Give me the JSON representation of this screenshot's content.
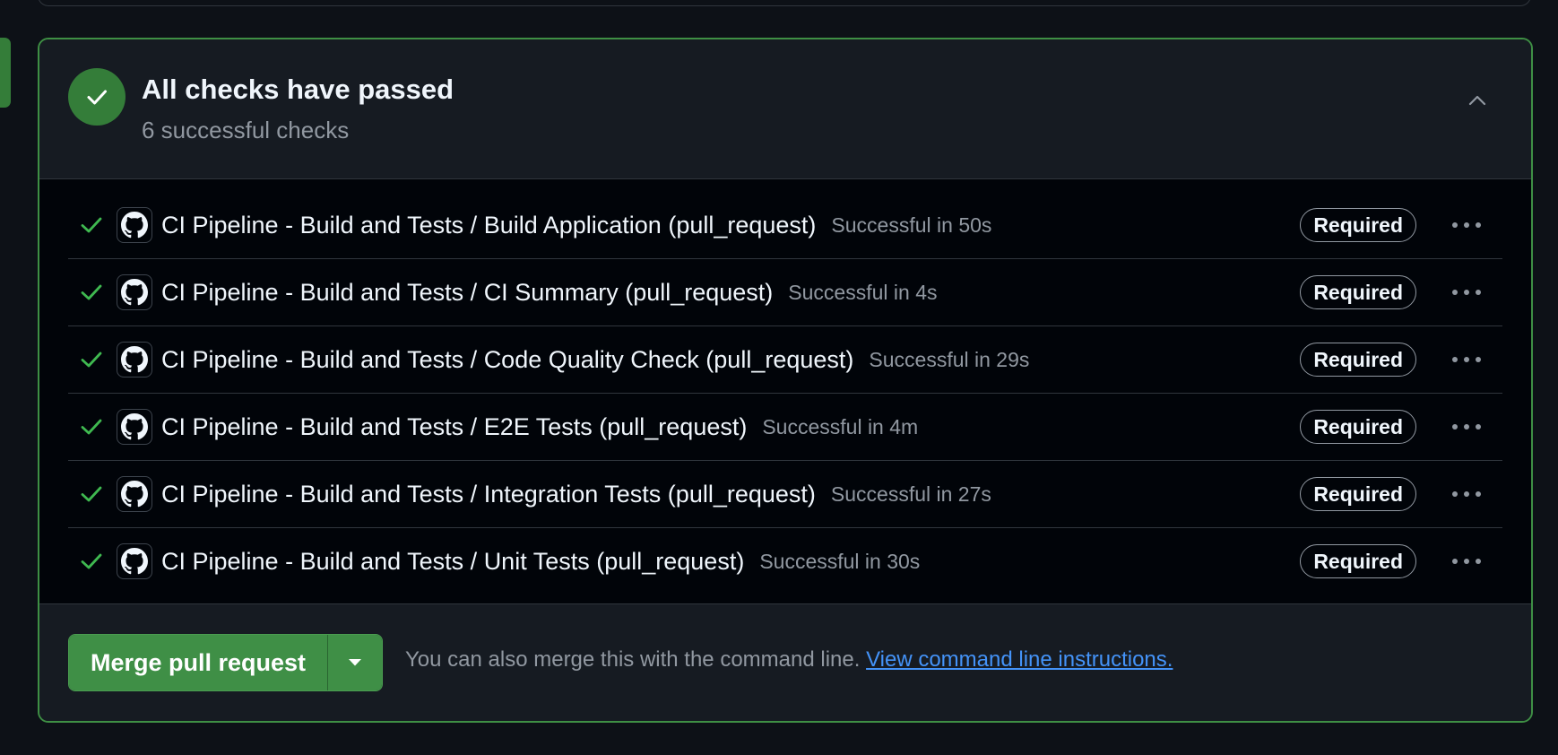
{
  "colors": {
    "success": "#347d39",
    "check_green": "#3fb950",
    "link": "#4493f8",
    "muted": "#9198a1",
    "border_success": "#3e8f44"
  },
  "summary": {
    "title": "All checks have passed",
    "subtitle": "6 successful checks",
    "status_icon": "check-circle-icon",
    "collapse_icon": "chevron-up-icon"
  },
  "checks": [
    {
      "name": "CI Pipeline - Build and Tests / Build Application (pull_request)",
      "status": "Successful in 50s",
      "badge": "Required",
      "icon": "github-icon"
    },
    {
      "name": "CI Pipeline - Build and Tests / CI Summary (pull_request)",
      "status": "Successful in 4s",
      "badge": "Required",
      "icon": "github-icon"
    },
    {
      "name": "CI Pipeline - Build and Tests / Code Quality Check (pull_request)",
      "status": "Successful in 29s",
      "badge": "Required",
      "icon": "github-icon"
    },
    {
      "name": "CI Pipeline - Build and Tests / E2E Tests (pull_request)",
      "status": "Successful in 4m",
      "badge": "Required",
      "icon": "github-icon"
    },
    {
      "name": "CI Pipeline - Build and Tests / Integration Tests (pull_request)",
      "status": "Successful in 27s",
      "badge": "Required",
      "icon": "github-icon"
    },
    {
      "name": "CI Pipeline - Build and Tests / Unit Tests (pull_request)",
      "status": "Successful in 30s",
      "badge": "Required",
      "icon": "github-icon"
    }
  ],
  "merge": {
    "button_label": "Merge pull request",
    "dropdown_icon": "triangle-down-icon",
    "hint": "You can also merge this with the command line.",
    "link_text": "View command line instructions."
  }
}
